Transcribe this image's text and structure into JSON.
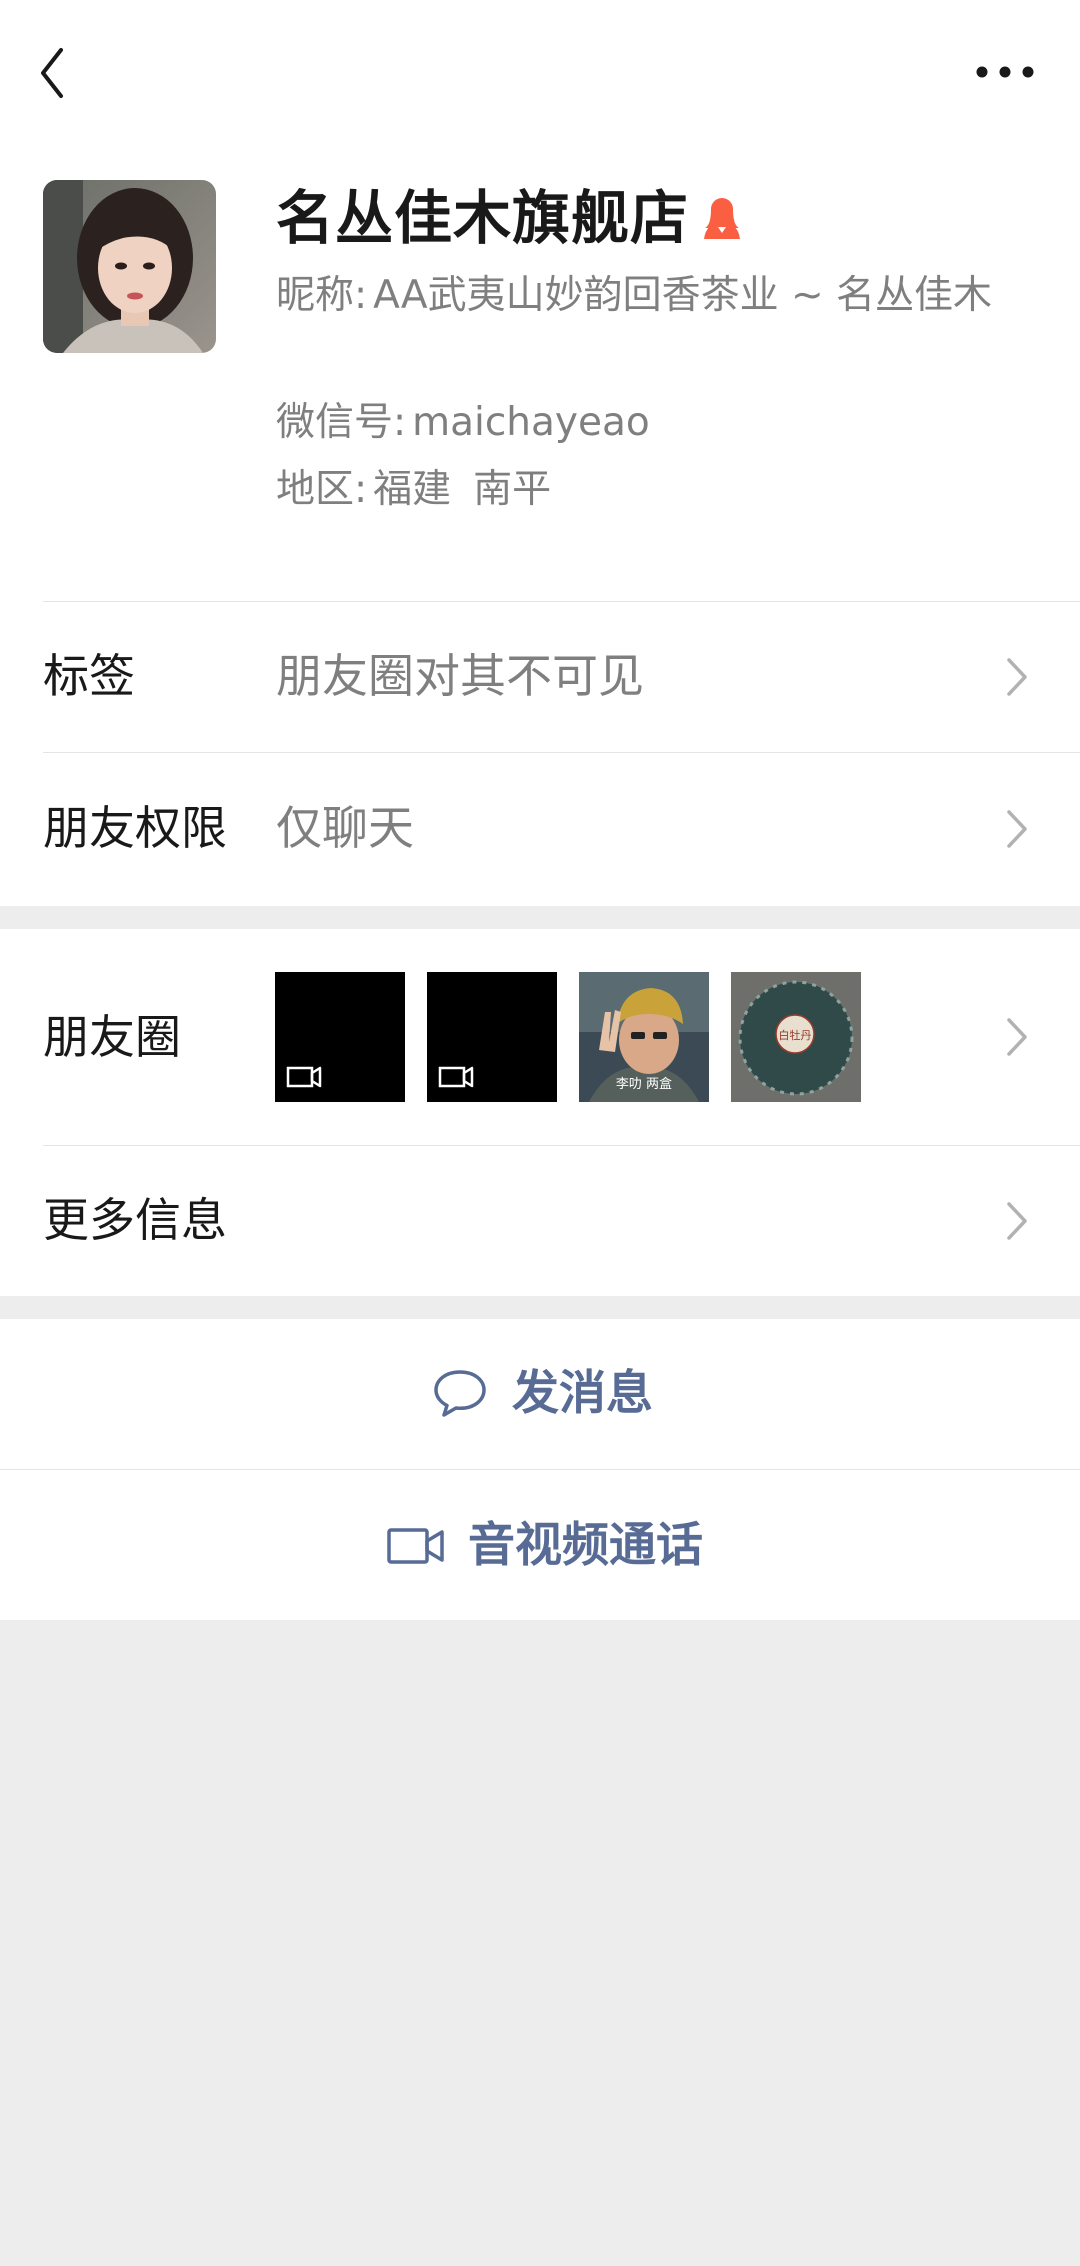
{
  "nav": {
    "back_icon": "chevron-left-icon",
    "more_icon": "more-dots-icon"
  },
  "profile": {
    "name": "名丛佳木旗舰店",
    "gender_icon": "female-icon",
    "gender_color": "#fa5f42",
    "nickname_label": "昵称:",
    "nickname": "AA武夷山妙韵回香茶业 ~ 名丛佳木",
    "wechat_id_label": "微信号:",
    "wechat_id": "maichayeao",
    "region_label": "地区:",
    "region_province": "福建",
    "region_city": "南平"
  },
  "rows": {
    "tags_label": "标签",
    "tags_value": "朋友圈对其不可见",
    "permission_label": "朋友权限",
    "permission_value": "仅聊天",
    "moments_label": "朋友圈",
    "more_info_label": "更多信息"
  },
  "moments": {
    "thumbs": [
      {
        "kind": "video",
        "icon": "video-camera-icon"
      },
      {
        "kind": "video",
        "icon": "video-camera-icon"
      },
      {
        "kind": "photo",
        "caption": "李叻 两盒"
      },
      {
        "kind": "photo",
        "caption": "白牡丹"
      }
    ]
  },
  "actions": {
    "message_label": "发消息",
    "message_icon": "chat-bubble-icon",
    "call_label": "音视频通话",
    "call_icon": "video-camera-icon",
    "accent_color": "#576b95"
  }
}
